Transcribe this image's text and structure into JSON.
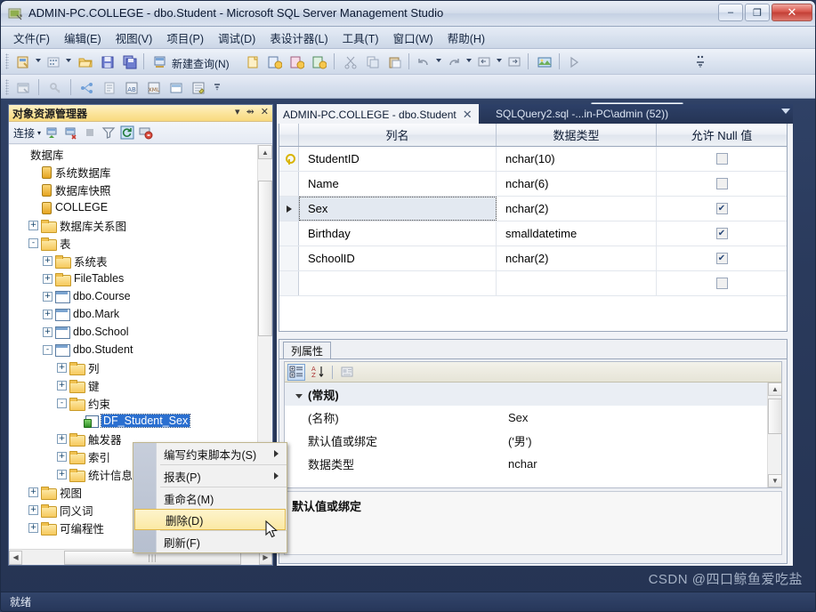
{
  "window": {
    "title": "ADMIN-PC.COLLEGE - dbo.Student - Microsoft SQL Server Management Studio",
    "app_icon": "sql-server-icon",
    "minimize": "–",
    "maximize": "❐",
    "close": "✕"
  },
  "menubar": {
    "items": [
      {
        "label": "文件(F)",
        "name": "menu-file"
      },
      {
        "label": "编辑(E)",
        "name": "menu-edit"
      },
      {
        "label": "视图(V)",
        "name": "menu-view"
      },
      {
        "label": "项目(P)",
        "name": "menu-project"
      },
      {
        "label": "调试(D)",
        "name": "menu-debug"
      },
      {
        "label": "表设计器(L)",
        "name": "menu-table-designer"
      },
      {
        "label": "工具(T)",
        "name": "menu-tools"
      },
      {
        "label": "窗口(W)",
        "name": "menu-window"
      },
      {
        "label": "帮助(H)",
        "name": "menu-help"
      }
    ]
  },
  "toolbar": {
    "new_query_label": "新建查询(N)",
    "icons": [
      "new-project-icon",
      "new-item-icon",
      "open-file-icon",
      "save-icon",
      "save-all-icon",
      "new-query-icon",
      "new-db-query-icon",
      "new-analysis-query-icon",
      "new-mdx-query-icon",
      "new-dmx-query-icon",
      "new-xmla-query-icon",
      "cut-icon",
      "copy-icon",
      "paste-icon",
      "undo-icon",
      "redo-icon",
      "navigate-back-icon",
      "navigate-forward-icon",
      "solution-explorer-icon",
      "run-icon"
    ],
    "combo_value": ""
  },
  "toolbar2": {
    "icons": [
      "table-designer-icon",
      "primary-key-icon",
      "relationships-icon",
      "manage-indexes-icon",
      "manage-fulltext-icon",
      "manage-xml-icon",
      "manage-check-constraints-icon",
      "generate-change-script-icon"
    ]
  },
  "object_explorer": {
    "title": "对象资源管理器",
    "dropdown_icon": "chevron-down-icon",
    "pin_icon": "pin-icon",
    "close_icon": "close-icon",
    "toolbar": {
      "connect_label": "连接",
      "icons": [
        "connect-icon",
        "disconnect-icon",
        "stop-icon",
        "filter-icon",
        "refresh-icon",
        "cancel-icon"
      ]
    },
    "tree": [
      {
        "label": "数据库",
        "depth": 0,
        "expander": "none",
        "icon": "none",
        "selected": false
      },
      {
        "label": "系统数据库",
        "depth": 1,
        "expander": "none",
        "icon": "database",
        "selected": false
      },
      {
        "label": "数据库快照",
        "depth": 1,
        "expander": "none",
        "icon": "database",
        "selected": false
      },
      {
        "label": "COLLEGE",
        "depth": 1,
        "expander": "none",
        "icon": "database",
        "selected": false
      },
      {
        "label": "数据库关系图",
        "depth": 1,
        "expander": "+",
        "icon": "folder",
        "selected": false
      },
      {
        "label": "表",
        "depth": 1,
        "expander": "-",
        "icon": "folder",
        "selected": false
      },
      {
        "label": "系统表",
        "depth": 2,
        "expander": "+",
        "icon": "folder",
        "selected": false
      },
      {
        "label": "FileTables",
        "depth": 2,
        "expander": "+",
        "icon": "folder",
        "selected": false
      },
      {
        "label": "dbo.Course",
        "depth": 2,
        "expander": "+",
        "icon": "table",
        "selected": false
      },
      {
        "label": "dbo.Mark",
        "depth": 2,
        "expander": "+",
        "icon": "table",
        "selected": false
      },
      {
        "label": "dbo.School",
        "depth": 2,
        "expander": "+",
        "icon": "table",
        "selected": false
      },
      {
        "label": "dbo.Student",
        "depth": 2,
        "expander": "-",
        "icon": "table",
        "selected": false
      },
      {
        "label": "列",
        "depth": 3,
        "expander": "+",
        "icon": "folder",
        "selected": false
      },
      {
        "label": "键",
        "depth": 3,
        "expander": "+",
        "icon": "folder",
        "selected": false
      },
      {
        "label": "约束",
        "depth": 3,
        "expander": "-",
        "icon": "folder",
        "selected": false
      },
      {
        "label": "DF_Student_Sex",
        "depth": 4,
        "expander": "none",
        "icon": "constraint",
        "selected": true
      },
      {
        "label": "触发器",
        "depth": 3,
        "expander": "+",
        "icon": "folder",
        "selected": false
      },
      {
        "label": "索引",
        "depth": 3,
        "expander": "+",
        "icon": "folder",
        "selected": false
      },
      {
        "label": "统计信息",
        "depth": 3,
        "expander": "+",
        "icon": "folder",
        "selected": false
      },
      {
        "label": "视图",
        "depth": 1,
        "expander": "+",
        "icon": "folder",
        "selected": false
      },
      {
        "label": "同义词",
        "depth": 1,
        "expander": "+",
        "icon": "folder",
        "selected": false
      },
      {
        "label": "可编程性",
        "depth": 1,
        "expander": "+",
        "icon": "folder",
        "selected": false
      }
    ]
  },
  "context_menu": {
    "items": [
      {
        "label": "编写约束脚本为(S)",
        "submenu": true,
        "highlighted": false,
        "name": "ctx-script-constraint-as"
      },
      {
        "label": "报表(P)",
        "submenu": true,
        "highlighted": false,
        "name": "ctx-reports"
      },
      {
        "label": "重命名(M)",
        "submenu": false,
        "highlighted": false,
        "name": "ctx-rename"
      },
      {
        "label": "删除(D)",
        "submenu": false,
        "highlighted": true,
        "name": "ctx-delete"
      },
      {
        "label": "刷新(F)",
        "submenu": false,
        "highlighted": false,
        "name": "ctx-refresh"
      }
    ]
  },
  "tabs": [
    {
      "label": "ADMIN-PC.COLLEGE - dbo.Student",
      "active": true,
      "closable": true,
      "name": "tab-table-designer"
    },
    {
      "label": "SQLQuery2.sql -...in-PC\\admin (52))",
      "active": false,
      "closable": false,
      "name": "tab-sqlquery2"
    }
  ],
  "grid": {
    "headers": [
      "",
      "列名",
      "数据类型",
      "允许 Null 值"
    ],
    "rows": [
      {
        "marker": "key",
        "name": "StudentID",
        "type": "nchar(10)",
        "allow_null": false,
        "current": false
      },
      {
        "marker": "",
        "name": "Name",
        "type": "nchar(6)",
        "allow_null": false,
        "current": false
      },
      {
        "marker": "arrow",
        "name": "Sex",
        "type": "nchar(2)",
        "allow_null": true,
        "current": true
      },
      {
        "marker": "",
        "name": "Birthday",
        "type": "smalldatetime",
        "allow_null": true,
        "current": false
      },
      {
        "marker": "",
        "name": "SchoolID",
        "type": "nchar(2)",
        "allow_null": true,
        "current": false
      },
      {
        "marker": "",
        "name": "",
        "type": "",
        "allow_null": false,
        "current": false
      }
    ]
  },
  "properties": {
    "tab_label": "列属性",
    "toolbar_icons": [
      "categorized-icon",
      "alphabetical-icon",
      "property-pages-icon"
    ],
    "rows": [
      {
        "key": "(常规)",
        "value": "",
        "category": true
      },
      {
        "key": "(名称)",
        "value": "Sex",
        "category": false
      },
      {
        "key": "默认值或绑定",
        "value": "('男')",
        "category": false
      },
      {
        "key": "数据类型",
        "value": "nchar",
        "category": false
      }
    ],
    "description_title": "默认值或绑定"
  },
  "statusbar": {
    "text": "就绪"
  },
  "watermark": {
    "text": "CSDN @四口鲸鱼爱吃盐"
  }
}
